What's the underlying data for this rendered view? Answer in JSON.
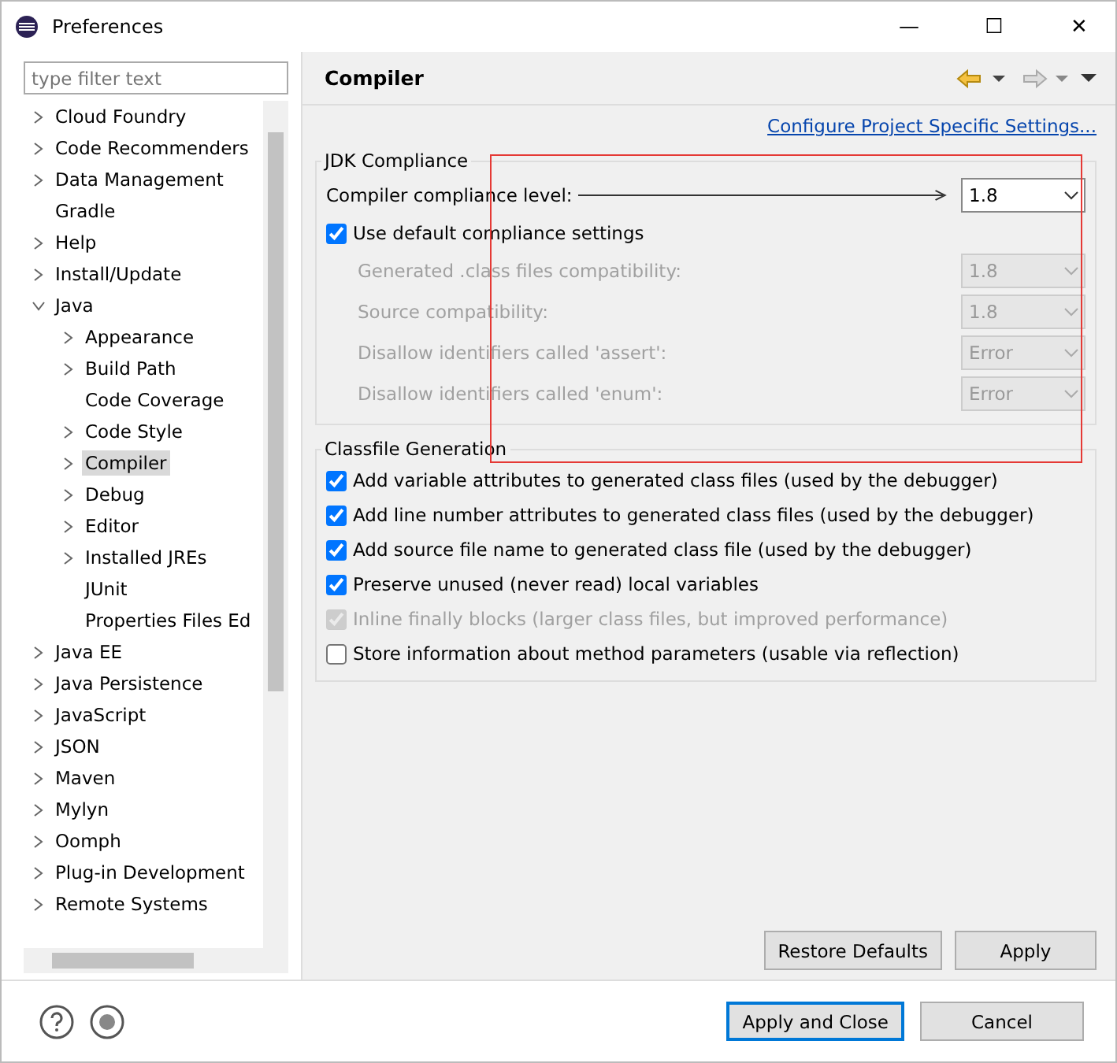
{
  "window": {
    "title": "Preferences",
    "controls": [
      "—",
      "☐",
      "✕"
    ]
  },
  "filter": {
    "placeholder": "type filter text"
  },
  "tree": [
    {
      "label": "Cloud Foundry",
      "kind": "collapsed",
      "selected": false
    },
    {
      "label": "Code Recommenders",
      "kind": "collapsed",
      "selected": false
    },
    {
      "label": "Data Management",
      "kind": "collapsed",
      "selected": false
    },
    {
      "label": "Gradle",
      "kind": "leaf",
      "selected": false
    },
    {
      "label": "Help",
      "kind": "collapsed",
      "selected": false
    },
    {
      "label": "Install/Update",
      "kind": "collapsed",
      "selected": false
    },
    {
      "label": "Java",
      "kind": "expanded",
      "selected": false,
      "children": [
        {
          "label": "Appearance",
          "kind": "collapsed",
          "selected": false
        },
        {
          "label": "Build Path",
          "kind": "collapsed",
          "selected": false
        },
        {
          "label": "Code Coverage",
          "kind": "leaf",
          "selected": false
        },
        {
          "label": "Code Style",
          "kind": "collapsed",
          "selected": false
        },
        {
          "label": "Compiler",
          "kind": "collapsed",
          "selected": true
        },
        {
          "label": "Debug",
          "kind": "collapsed",
          "selected": false
        },
        {
          "label": "Editor",
          "kind": "collapsed",
          "selected": false
        },
        {
          "label": "Installed JREs",
          "kind": "collapsed",
          "selected": false
        },
        {
          "label": "JUnit",
          "kind": "leaf",
          "selected": false
        },
        {
          "label": "Properties Files Ed",
          "kind": "leaf",
          "selected": false
        }
      ]
    },
    {
      "label": "Java EE",
      "kind": "collapsed",
      "selected": false
    },
    {
      "label": "Java Persistence",
      "kind": "collapsed",
      "selected": false
    },
    {
      "label": "JavaScript",
      "kind": "collapsed",
      "selected": false
    },
    {
      "label": "JSON",
      "kind": "collapsed",
      "selected": false
    },
    {
      "label": "Maven",
      "kind": "collapsed",
      "selected": false
    },
    {
      "label": "Mylyn",
      "kind": "collapsed",
      "selected": false
    },
    {
      "label": "Oomph",
      "kind": "collapsed",
      "selected": false
    },
    {
      "label": "Plug-in Development",
      "kind": "collapsed",
      "selected": false
    },
    {
      "label": "Remote Systems",
      "kind": "collapsed",
      "selected": false
    }
  ],
  "page": {
    "title": "Compiler",
    "link": "Configure Project Specific Settings...",
    "jdk": {
      "title": "JDK Compliance",
      "level_label": "Compiler compliance level:",
      "level_value": "1.8",
      "use_default": {
        "label": "Use default compliance settings",
        "checked": true
      },
      "rows": [
        {
          "label": "Generated .class files compatibility:",
          "value": "1.8",
          "disabled": true
        },
        {
          "label": "Source compatibility:",
          "value": "1.8",
          "disabled": true
        },
        {
          "label": "Disallow identifiers called 'assert':",
          "value": "Error",
          "disabled": true
        },
        {
          "label": "Disallow identifiers called 'enum':",
          "value": "Error",
          "disabled": true
        }
      ]
    },
    "classfile": {
      "title": "Classfile Generation",
      "options": [
        {
          "label": "Add variable attributes to generated class files (used by the debugger)",
          "checked": true,
          "disabled": false
        },
        {
          "label": "Add line number attributes to generated class files (used by the debugger)",
          "checked": true,
          "disabled": false
        },
        {
          "label": "Add source file name to generated class file (used by the debugger)",
          "checked": true,
          "disabled": false
        },
        {
          "label": "Preserve unused (never read) local variables",
          "checked": true,
          "disabled": false
        },
        {
          "label": "Inline finally blocks (larger class files, but improved performance)",
          "checked": true,
          "disabled": true
        },
        {
          "label": "Store information about method parameters (usable via reflection)",
          "checked": false,
          "disabled": false
        }
      ]
    },
    "buttons": [
      "Restore Defaults",
      "Apply"
    ]
  },
  "footer": {
    "buttons": [
      {
        "label": "Apply and Close",
        "default": true
      },
      {
        "label": "Cancel",
        "default": false
      }
    ]
  }
}
